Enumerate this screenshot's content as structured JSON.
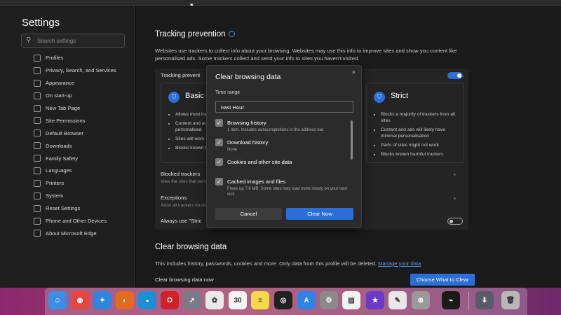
{
  "sidebar": {
    "title": "Settings",
    "search_placeholder": "Search settings",
    "items": [
      {
        "label": "Profiles"
      },
      {
        "label": "Privacy, Search, and Services"
      },
      {
        "label": "Appearance"
      },
      {
        "label": "On start-up"
      },
      {
        "label": "New Tab Page"
      },
      {
        "label": "Site Permissions"
      },
      {
        "label": "Default Browser"
      },
      {
        "label": "Downloads"
      },
      {
        "label": "Family Safety"
      },
      {
        "label": "Languages"
      },
      {
        "label": "Printers"
      },
      {
        "label": "System"
      },
      {
        "label": "Reset Settings"
      },
      {
        "label": "Phone and Other Devices"
      },
      {
        "label": "About Microsoft Edge"
      }
    ]
  },
  "tracking": {
    "title": "Tracking prevention",
    "description": "Websites use trackers to collect info about your browsing. Websites may use this info to improve sites and show you content like personalised ads. Some trackers collect and send your info to sites you haven't visited.",
    "panel_label": "Tracking prevent",
    "toggle_on": true,
    "basic": {
      "title": "Basic",
      "bullets": [
        "Allows most trackers across all sites",
        "Content and ads will likely be personalised",
        "Sites will work as expected",
        "Blocks known harmful trackers"
      ]
    },
    "strict": {
      "title": "Strict",
      "bullets": [
        "Blocks a majority of trackers from all sites",
        "Content and ads will likely have minimal personalisation",
        "Parts of sites might not work",
        "Blocks known harmful trackers"
      ]
    },
    "blocked_title": "Blocked trackers",
    "blocked_sub": "View the sites that we've blocked from tracking you",
    "exceptions_title": "Exceptions",
    "exceptions_sub": "Allow all trackers on sites you choose",
    "always_use": "Always use \"Stric"
  },
  "clear_section": {
    "title": "Clear browsing data",
    "description": "This includes history, passwords, cookies and more. Only data from this profile will be deleted.",
    "manage_link": "Manage your data",
    "row_label": "Clear browsing data now",
    "choose_button": "Choose What to Clear"
  },
  "modal": {
    "title": "Clear browsing data",
    "close": "×",
    "time_range_label": "Time range",
    "time_range_value": "Last Hour",
    "options": [
      {
        "label": "Browsing history",
        "desc": "1 item. Includes autocompletions in the address bar.",
        "checked": true
      },
      {
        "label": "Download history",
        "desc": "None",
        "checked": true
      },
      {
        "label": "Cookies and other site data",
        "desc": "",
        "checked": true
      },
      {
        "label": "Cached images and files",
        "desc": "Frees up 7.6 MB. Some sites may load more slowly on your next visit.",
        "checked": true
      }
    ],
    "cancel": "Cancel",
    "clear": "Clear Now"
  },
  "dock": {
    "icons": [
      {
        "name": "finder-icon",
        "color": "#3a8ee6",
        "glyph": "☺"
      },
      {
        "name": "chrome-icon",
        "color": "#e8453c",
        "glyph": "◉"
      },
      {
        "name": "safari-icon",
        "color": "#2e86de",
        "glyph": "✦"
      },
      {
        "name": "firefox-icon",
        "color": "#e66a1e",
        "glyph": "◐"
      },
      {
        "name": "edge-icon",
        "color": "#1b8fd6",
        "glyph": "◒"
      },
      {
        "name": "opera-icon",
        "color": "#d0202a",
        "glyph": "O"
      },
      {
        "name": "launchpad-icon",
        "color": "#7a7a8a",
        "glyph": "➚"
      },
      {
        "name": "photos-icon",
        "color": "#e9e9e9",
        "glyph": "✿"
      },
      {
        "name": "calendar-icon",
        "color": "#f4f4f4",
        "glyph": "30"
      },
      {
        "name": "notes-icon",
        "color": "#f6d94a",
        "glyph": "≡"
      },
      {
        "name": "obs-icon",
        "color": "#202020",
        "glyph": "◎"
      },
      {
        "name": "app-store-icon",
        "color": "#2c84e8",
        "glyph": "A"
      },
      {
        "name": "system-preferences-icon",
        "color": "#8a8a8a",
        "glyph": "⚙"
      },
      {
        "name": "textedit-icon",
        "color": "#f2f2f2",
        "glyph": "▤"
      },
      {
        "name": "imovie-icon",
        "color": "#6a3ac9",
        "glyph": "★"
      },
      {
        "name": "script-editor-icon",
        "color": "#e8e8e8",
        "glyph": "✎"
      },
      {
        "name": "preview-icon",
        "color": "#9a9a9a",
        "glyph": "⊕"
      },
      {
        "name": "activity-monitor-icon",
        "color": "#1a1a1a",
        "glyph": "⌁"
      },
      {
        "name": "downloads-folder-icon",
        "color": "#5a5a6a",
        "glyph": "⬇"
      },
      {
        "name": "trash-icon",
        "color": "#b8b8b8",
        "glyph": "🗑"
      }
    ],
    "calendar_day": "30"
  }
}
